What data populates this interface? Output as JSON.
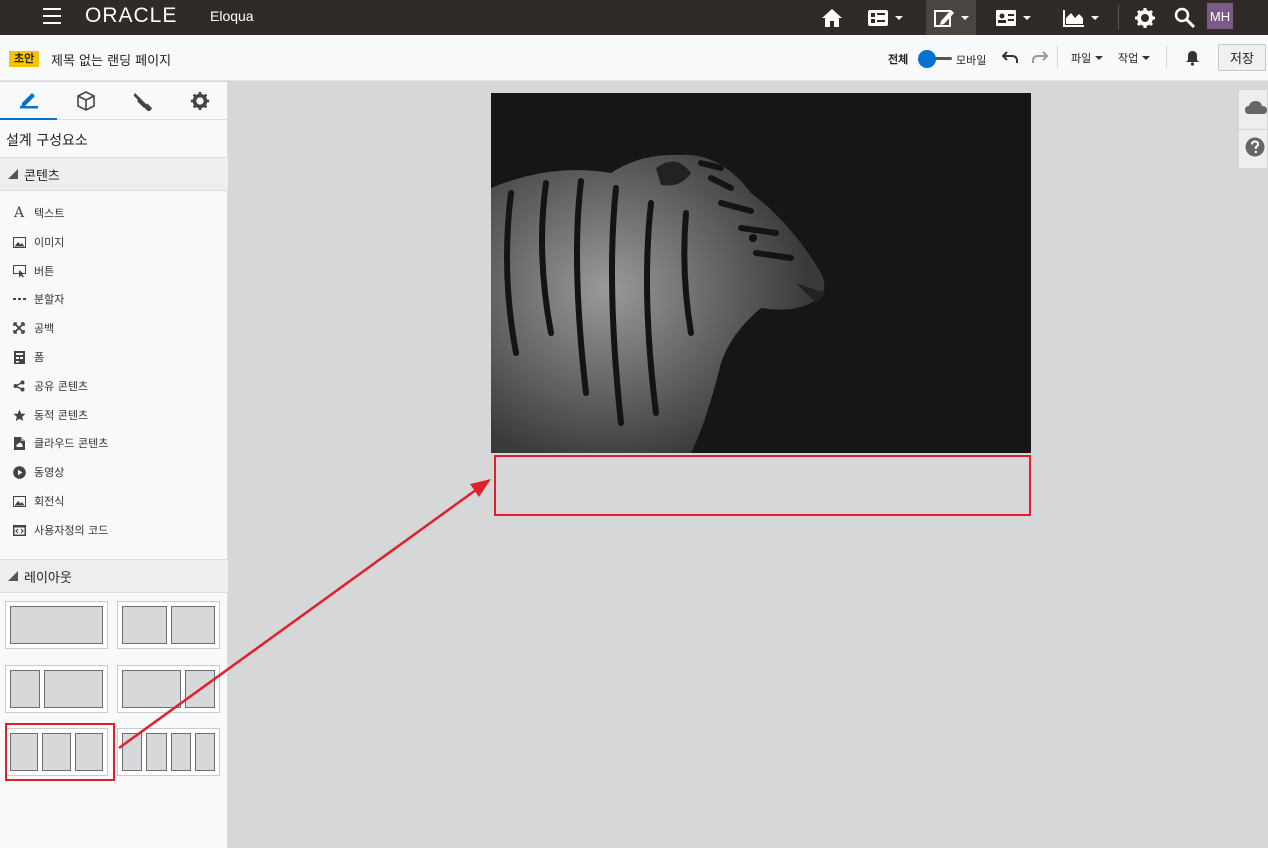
{
  "topbar": {
    "logo": "ORACLE",
    "app_name": "Eloqua",
    "avatar_initials": "MH",
    "icons": [
      "home-icon",
      "dashboard-icon",
      "edit-icon",
      "contacts-icon",
      "chart-icon",
      "gear-icon",
      "search-icon"
    ]
  },
  "subbar": {
    "status_badge": "초안",
    "page_title": "제목 없는 랜딩 페이지",
    "view_full_label": "전체",
    "view_mobile_label": "모바일",
    "file_menu": "파일",
    "action_menu": "작업",
    "save_label": "저장"
  },
  "leftpanel": {
    "tab_icons": [
      "pencil-icon",
      "cube-icon",
      "brush-icon",
      "gear-icon"
    ],
    "title": "설계 구성요소",
    "content_section": "콘텐츠",
    "components": [
      {
        "label": "텍스트",
        "icon": "text-icon"
      },
      {
        "label": "이미지",
        "icon": "image-icon"
      },
      {
        "label": "버튼",
        "icon": "button-icon"
      },
      {
        "label": "분할자",
        "icon": "divider-icon"
      },
      {
        "label": "공백",
        "icon": "spacer-icon"
      },
      {
        "label": "폼",
        "icon": "form-icon"
      },
      {
        "label": "공유 콘텐츠",
        "icon": "share-icon"
      },
      {
        "label": "동적 콘텐츠",
        "icon": "star-icon"
      },
      {
        "label": "클라우드 콘텐츠",
        "icon": "cloud-doc-icon"
      },
      {
        "label": "동영상",
        "icon": "play-icon"
      },
      {
        "label": "회전식",
        "icon": "carousel-icon"
      },
      {
        "label": "사용자정의 코드",
        "icon": "code-icon"
      }
    ],
    "layout_section": "레이아웃"
  },
  "colors": {
    "topbar_bg": "#302b28",
    "accent": "#0572ce",
    "badge": "#f5c400",
    "highlight": "#e0202a",
    "avatar": "#7b5a86"
  }
}
